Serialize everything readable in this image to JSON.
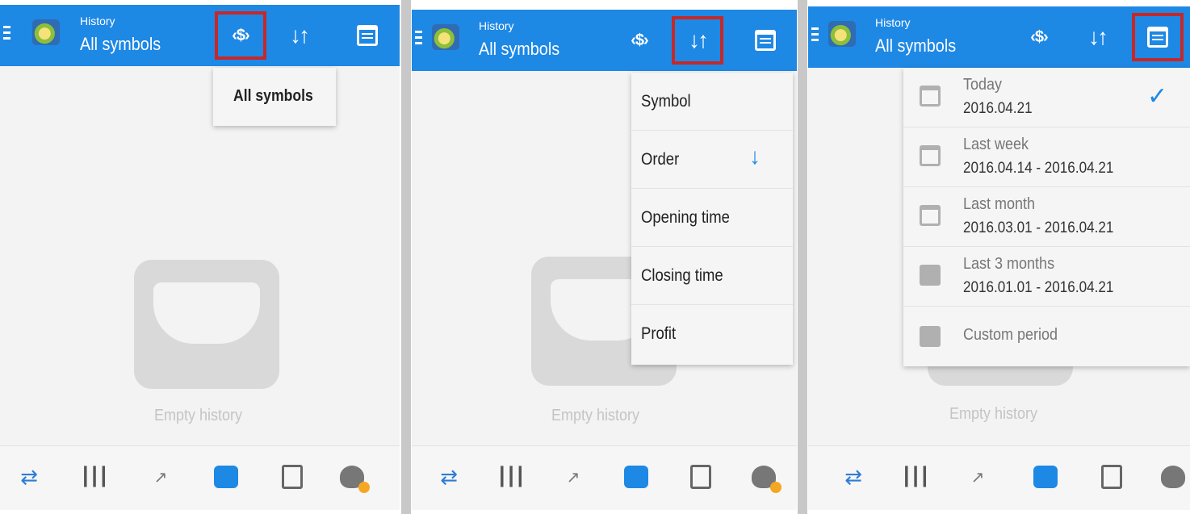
{
  "app": {
    "header_small": "History",
    "header_big": "All symbols"
  },
  "icons": {
    "symbol_filter": "symbol-filter-icon",
    "sort": "sort-icon",
    "calendar": "calendar-icon"
  },
  "colors": {
    "appbar": "#1e88e5",
    "highlight": "#c62828"
  },
  "empty_state": "Empty history",
  "panel1": {
    "menu": [
      "All symbols"
    ]
  },
  "panel2": {
    "menu": [
      {
        "label": "Symbol",
        "selected": false
      },
      {
        "label": "Order",
        "selected": true,
        "indicator": "↓"
      },
      {
        "label": "Opening time",
        "selected": false
      },
      {
        "label": "Closing time",
        "selected": false
      },
      {
        "label": "Profit",
        "selected": false
      }
    ]
  },
  "panel3": {
    "menu": [
      {
        "label": "Today",
        "range": "2016.04.21",
        "checked": true
      },
      {
        "label": "Last week",
        "range": "2016.04.14 - 2016.04.21",
        "checked": false
      },
      {
        "label": "Last month",
        "range": "2016.03.01 - 2016.04.21",
        "checked": false
      },
      {
        "label": "Last 3 months",
        "range": "2016.01.01 - 2016.04.21",
        "checked": false
      },
      {
        "label": "Custom period",
        "range": "",
        "checked": false
      }
    ],
    "check_mark": "✓"
  },
  "bottom_nav": [
    "quotes-icon",
    "charts-icon",
    "trade-icon",
    "history-icon",
    "news-icon",
    "chat-icon"
  ]
}
